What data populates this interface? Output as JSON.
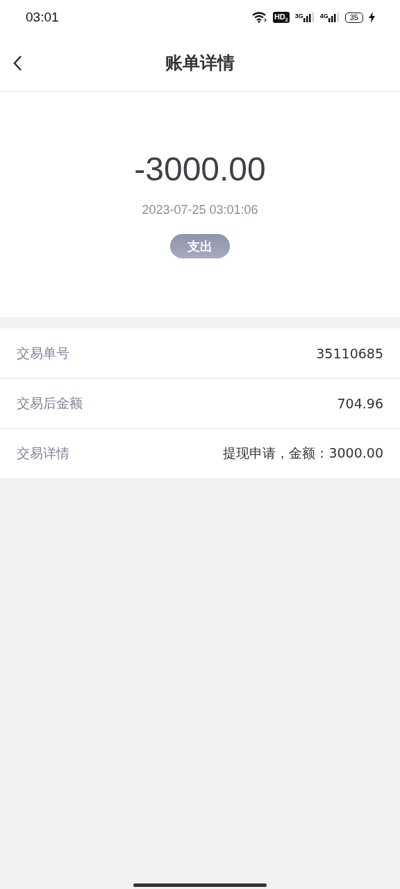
{
  "status_bar": {
    "time": "03:01",
    "hd": "HD$_{2}$",
    "networks": [
      "3G",
      "4G"
    ],
    "battery": "35"
  },
  "header": {
    "title": "账单详情"
  },
  "summary": {
    "amount": "-3000.00",
    "datetime": "2023-07-25 03:01:06",
    "type_tag": "支出"
  },
  "details": [
    {
      "label": "交易单号",
      "value": "35110685"
    },
    {
      "label": "交易后金额",
      "value": "704.96"
    },
    {
      "label": "交易详情",
      "value": "提现申请，金额：3000.00"
    }
  ]
}
